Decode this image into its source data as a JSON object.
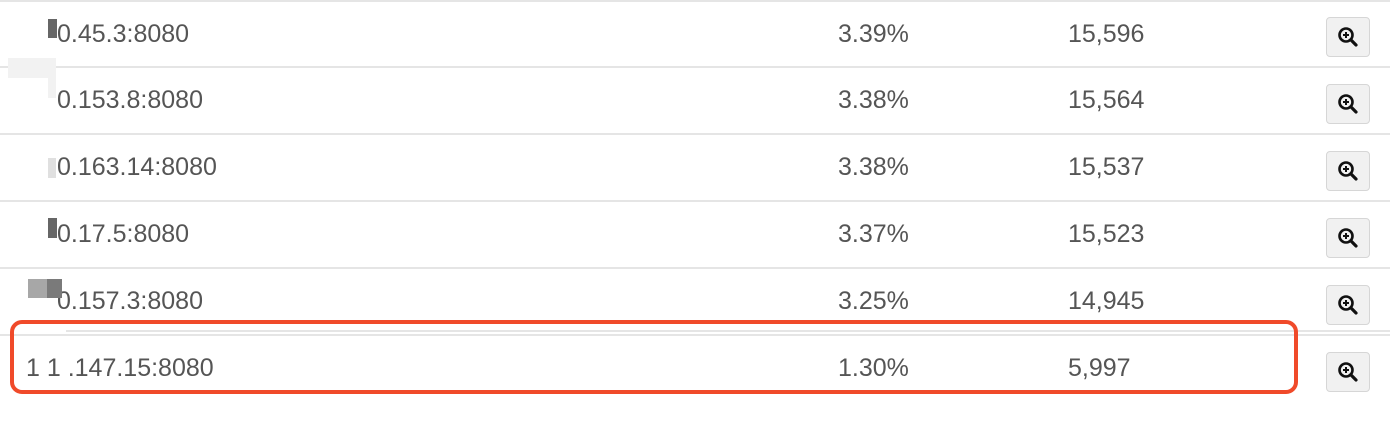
{
  "rows": [
    {
      "host": "0.45.3:8080",
      "percent": "3.39%",
      "count": "15,596"
    },
    {
      "host": "0.153.8:8080",
      "percent": "3.38%",
      "count": "15,564"
    },
    {
      "host": "0.163.14:8080",
      "percent": "3.38%",
      "count": "15,537"
    },
    {
      "host": "0.17.5:8080",
      "percent": "3.37%",
      "count": "15,523"
    },
    {
      "host": "0.157.3:8080",
      "percent": "3.25%",
      "count": "14,945"
    },
    {
      "host": "1 1 .147.15:8080",
      "percent": "1.30%",
      "count": "5,997"
    }
  ],
  "actions": {
    "zoom_icon": "zoom-in-icon"
  },
  "colors": {
    "highlight": "#f04a2a",
    "divider": "#e5e5e5",
    "text": "#555555"
  }
}
